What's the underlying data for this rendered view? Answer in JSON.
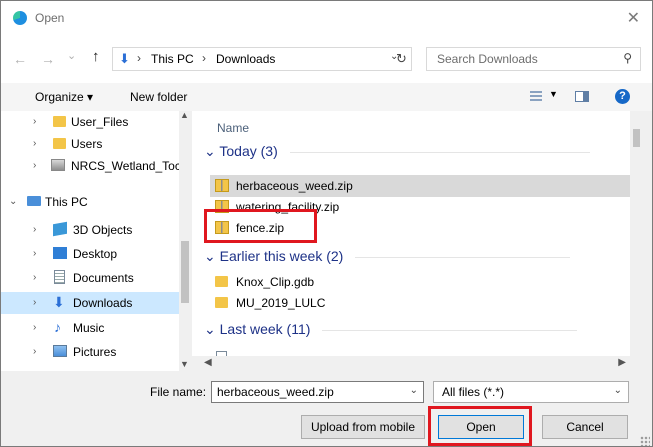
{
  "window": {
    "title": "Open",
    "close_glyph": "✕"
  },
  "navigation": {
    "back_glyph": "←",
    "forward_glyph": "→",
    "recent_glyph": "⌄",
    "up_glyph": "↑",
    "breadcrumbs": [
      "This PC",
      "Downloads"
    ],
    "breadcrumb_separator": "›",
    "dropdown_glyph": "⌄",
    "refresh_glyph": "↻",
    "search": {
      "placeholder": "Search Downloads",
      "icon": "search-icon"
    }
  },
  "toolbar": {
    "organize_label": "Organize ▾",
    "new_folder_label": "New folder"
  },
  "tree": {
    "items": [
      {
        "label": "User_Files",
        "icon": "folder-icon",
        "expander": "›"
      },
      {
        "label": "Users",
        "icon": "folder-icon",
        "expander": "›"
      },
      {
        "label": "NRCS_Wetland_Toc",
        "icon": "toolbox-icon",
        "expander": "›"
      },
      {
        "label": "This PC",
        "icon": "computer-icon",
        "expander": "⌄"
      },
      {
        "label": "3D Objects",
        "icon": "cube-icon",
        "expander": "›"
      },
      {
        "label": "Desktop",
        "icon": "desktop-icon",
        "expander": "›"
      },
      {
        "label": "Documents",
        "icon": "document-icon",
        "expander": "›"
      },
      {
        "label": "Downloads",
        "icon": "download-icon",
        "expander": "›"
      },
      {
        "label": "Music",
        "icon": "music-icon",
        "expander": "›"
      },
      {
        "label": "Pictures",
        "icon": "pictures-icon",
        "expander": "›"
      }
    ],
    "selected_item": "Downloads"
  },
  "files": {
    "column_header": "Name",
    "groups": [
      {
        "label": "Today (3)",
        "items": [
          "herbaceous_weed.zip",
          "watering_facility.zip",
          "fence.zip"
        ]
      },
      {
        "label": "Earlier this week (2)",
        "items": [
          "Knox_Clip.gdb",
          "MU_2019_LULC"
        ]
      },
      {
        "label": "Last week (11)",
        "items": []
      }
    ],
    "selected_file": "herbaceous_weed.zip"
  },
  "footer": {
    "file_name_label": "File name:",
    "file_name_value": "herbaceous_weed.zip",
    "file_type_value": "All files (*.*)",
    "upload_label": "Upload from mobile",
    "open_label": "Open",
    "cancel_label": "Cancel"
  },
  "colors": {
    "highlight_box": "#e0171f",
    "selection": "#cce8ff",
    "group_header": "#1e3287",
    "folder": "#f3c548"
  }
}
